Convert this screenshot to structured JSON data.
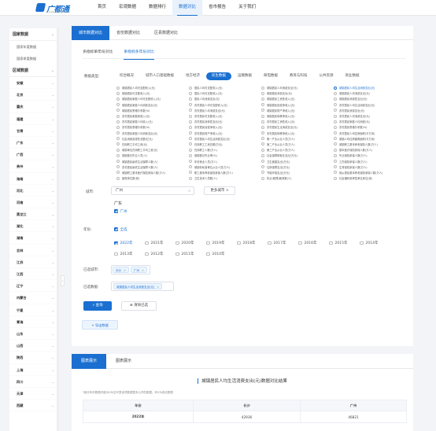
{
  "logo": {
    "text": "广都通",
    "sub": "广州市统计局数据开放平台"
  },
  "nav": [
    "首页",
    "宏观数据",
    "数据排行",
    "数据对比",
    "省市报告",
    "关于我们"
  ],
  "sidebar": {
    "national": "国家数据",
    "national_items": [
      "国家年度数据",
      "国家季度数据"
    ],
    "region": "区域数据",
    "regions": [
      "安徽",
      "北京",
      "重庆",
      "福建",
      "甘肃",
      "广东",
      "广西",
      "贵州",
      "海南",
      "河北",
      "河南",
      "黑龙江",
      "湖北",
      "湖南",
      "吉林",
      "江苏",
      "江西",
      "辽宁",
      "内蒙古",
      "宁夏",
      "青海",
      "山东",
      "山西",
      "陕西",
      "上海",
      "四川",
      "天津",
      "西藏"
    ]
  },
  "tabs_main": [
    "城市数据对比",
    "省份数据对比",
    "区县数据对比"
  ],
  "tabs_sub": [
    "多指标单年份对比",
    "单指标多年份对比"
  ],
  "form": {
    "category_label": "数据类型:",
    "categories": [
      "综合概况",
      "城市人口基础数据",
      "地方经济",
      "民生数据",
      "运输数据",
      "邮电数据",
      "教育与科技",
      "公共资源",
      "商业数据"
    ],
    "indicators": [
      "城镇居民人均可支配收入(元)",
      "居民人均可支配收入(元)",
      "城镇居民人均消费支出(元)",
      "城镇居民人均生活消费支出(元)",
      "城镇居民可支配收入(元)",
      "居民人均可支配收入(元)",
      "城镇居民消费支出(元)",
      "城镇居民人均消费支出(元)",
      "城镇居民家庭人均可支配收入(元)",
      "居民人均消费支出(元)",
      "城镇居民工资性收入(元)",
      "城镇居民消费性支出(元)",
      "城镇居民家庭人均消费支出(元)",
      "农村居民人均可支配收入(元)",
      "城镇居民经营净收入(元)",
      "农村居民人均生活消费支出(元)",
      "城镇居民恩格尔系数(%)",
      "农村居民人均消费支出(元)",
      "城镇居民财产净收入(元)",
      "农村居民消费支出(元)",
      "农村居民家庭纯收入(元)",
      "农村居民可支配收入(元)",
      "城镇居民转移净收入(元)",
      "农村居民人均消费支出(元)",
      "农村居民家庭人均收入(元)",
      "农村居民消费性支出(元)",
      "农村居民工资性收入(元)",
      "农村居民家庭人均消费(元)",
      "农村居民恩格尔系数(%)",
      "农村居民经营净收入(元)",
      "农村居民生活消费支出(元)",
      "农村居民恩格尔系数(%)",
      "农村居民家庭人均消费支出(元)",
      "农村居民财产净收入(元)",
      "农村居民转移净收入(元)",
      "农村居民人均住房面积(平方米)",
      "社会消费品零售总额(亿元)",
      "农村居民人均生活消费支出(元)",
      "第一产业从业人员(万人)",
      "城镇人均住房建筑面积(平方米)",
      "在岗职工平均工资(元)",
      "在岗职工工资总额(万元)",
      "第二产业从业人员(万人)",
      "城镇职工基本养老保险人数(万人)",
      "城镇单位在岗职工平均工资(元)",
      "在岗职工人数(万人)",
      "第三产业从业人员(万人)",
      "基本医疗保险参保人数(万人)",
      "城镇登记失业人员(人)",
      "城镇登记失业率(%)",
      "社会保障和就业支出(万元)",
      "失业保险参保人数(万人)",
      "城镇居民最低生活保障人数(人)",
      "年末就业人员(万人)",
      "卫生健康支出(万元)",
      "工伤保险参保人数(万人)",
      "农村居民最低生活保障人数(人)",
      "城镇非私营单位从业人员(万人)",
      "住房保障支出(万元)",
      "生育保险参保人数(万人)",
      "城镇职工基本医疗保险参保人数(万人)",
      "职工基本养老保险参保人数(万人)",
      "节能环保支出(万元)",
      "城乡居民基本养老保险参保人数(万人)",
      "医院床位数(张)",
      "卫生技术人员数(人)",
      "执业(助理)医师数(人)",
      "社会福利收养性单位床位(张)"
    ],
    "selected_indicator": 3,
    "city_label": "城市:",
    "city_placeholder": "广州",
    "more_city": "更多城市 >",
    "province": "广东",
    "city_check": "广州",
    "year_label": "年份:",
    "select_all": "全选",
    "years": [
      "2022年",
      "2021年",
      "2020年",
      "2019年",
      "2018年",
      "2017年",
      "2016年",
      "2015年",
      "2014年",
      "2013年",
      "2012年",
      "2011年",
      "2010年"
    ],
    "selected_city_label": "已选城市:",
    "selected_city_tags": [
      "长沙",
      "广州"
    ],
    "selected_data_label": "已选数据:",
    "selected_data_tag": "城镇居民人均生活消费支出(元)",
    "query_btn": "查询",
    "clear_btn": "清除已选",
    "export_btn": "+ 导出数据"
  },
  "results": {
    "tabs": [
      "图表展示",
      "图表展示"
    ],
    "title": "城镇居民人均生活消费支出(元)数据对比结果",
    "note": "*部分年份数据可能为0为空代表该项数据暂未公开的数据，非0为真实数据",
    "columns": [
      "年份",
      "长沙",
      "广州"
    ],
    "rows": [
      [
        "2022年",
        "42936",
        "46821"
      ]
    ]
  }
}
